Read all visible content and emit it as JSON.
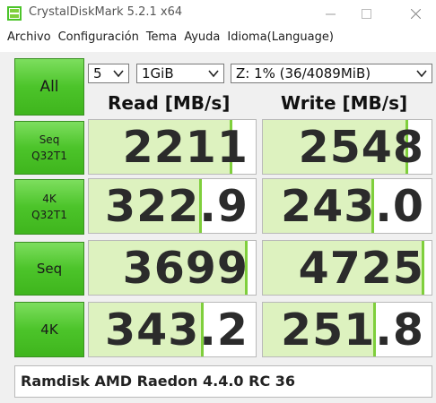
{
  "window": {
    "title": "CrystalDiskMark 5.2.1 x64"
  },
  "menu": {
    "items": [
      "Archivo",
      "Configuración",
      "Tema",
      "Ayuda",
      "Idioma(Language)"
    ]
  },
  "controls": {
    "all_label": "All",
    "test_count": "5",
    "test_size": "1GiB",
    "drive": "Z: 1% (36/4089MiB)"
  },
  "columns": {
    "read": "Read [MB/s]",
    "write": "Write [MB/s]"
  },
  "tests": [
    {
      "line1": "Seq",
      "line2": "Q32T1",
      "read": "2211",
      "write": "2548",
      "read_fraction": 0.86,
      "write_fraction": 0.86
    },
    {
      "line1": "4K",
      "line2": "Q32T1",
      "read": "322.9",
      "write": "243.0",
      "read_fraction": 0.68,
      "write_fraction": 0.66
    },
    {
      "line1": "Seq",
      "line2": "",
      "read": "3699",
      "write": "4725",
      "read_fraction": 0.95,
      "write_fraction": 0.96
    },
    {
      "line1": "4K",
      "line2": "",
      "read": "343.2",
      "write": "251.8",
      "read_fraction": 0.69,
      "write_fraction": 0.67
    }
  ],
  "comment": "Ramdisk AMD Raedon 4.4.0 RC 36",
  "colors": {
    "button_green": "#4cc42a",
    "bar_fill": "#ddf2bf",
    "bar_edge": "#7fcf3c"
  }
}
